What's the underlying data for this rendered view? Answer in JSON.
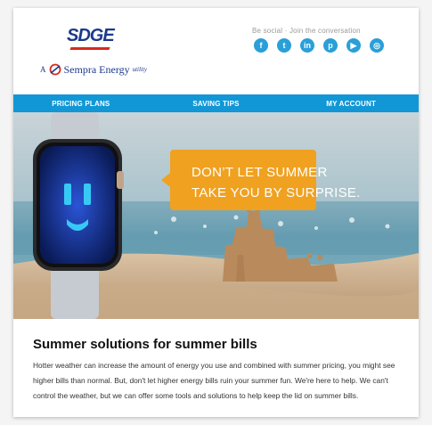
{
  "header": {
    "logo_text": "SDGE",
    "tagline": {
      "prefix": "A",
      "name": "Sempra Energy",
      "suffix": "utility"
    },
    "social_caption": "Be social · Join the conversation",
    "social_icons": [
      {
        "name": "facebook-icon",
        "glyph": "f"
      },
      {
        "name": "twitter-icon",
        "glyph": "t"
      },
      {
        "name": "linkedin-icon",
        "glyph": "in"
      },
      {
        "name": "pinterest-icon",
        "glyph": "p"
      },
      {
        "name": "youtube-icon",
        "glyph": "▶"
      },
      {
        "name": "instagram-icon",
        "glyph": "◎"
      }
    ]
  },
  "nav": {
    "items": [
      "PRICING PLANS",
      "SAVING TIPS",
      "MY ACCOUNT"
    ]
  },
  "hero": {
    "line1": "DON’T LET SUMMER",
    "line2": "TAKE YOU BY SURPRISE."
  },
  "content": {
    "headline": "Summer solutions for summer bills",
    "body": "Hotter weather can increase the amount of energy you use and combined with summer pricing, you might see higher bills than normal. But, don't let higher energy bills ruin your summer fun. We're here to help. We can't control the weather, but we can offer some tools and solutions to help keep the lid on summer bills."
  },
  "colors": {
    "nav_blue": "#1197d6",
    "bubble_orange": "#f0a120",
    "brand_navy": "#1b3a8c",
    "brand_red": "#d52b1e",
    "social_blue": "#2a9fd8"
  }
}
